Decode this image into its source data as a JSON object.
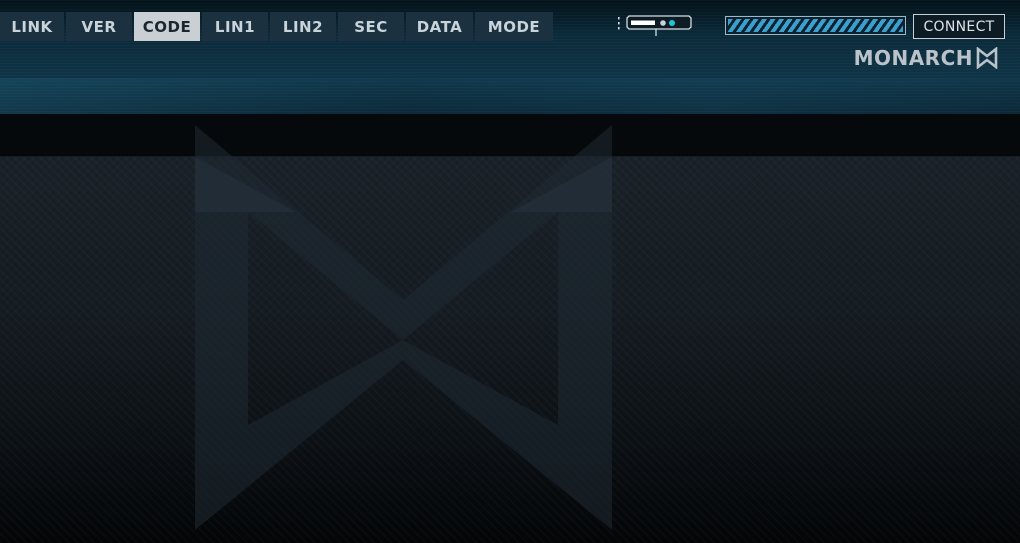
{
  "tabs": [
    {
      "label": "LINK",
      "active": false
    },
    {
      "label": "VER",
      "active": false
    },
    {
      "label": "CODE",
      "active": true
    },
    {
      "label": "LIN1",
      "active": false
    },
    {
      "label": "LIN2",
      "active": false
    },
    {
      "label": "SEC",
      "active": false
    },
    {
      "label": "DATA",
      "active": false
    },
    {
      "label": "MODE",
      "active": false
    }
  ],
  "device": {
    "icon": "device-module-icon"
  },
  "connection": {
    "level": 1.0,
    "color": "#3ca0cf"
  },
  "connect_button": {
    "label": "CONNECT"
  },
  "brand": {
    "name": "MONARCH",
    "logo": "monarch-bowtie-logo"
  },
  "colors": {
    "header": "#0f3548",
    "tab_bg": "#1c3140",
    "tab_active_bg": "#c9cfd3",
    "accent": "#3ca0cf"
  }
}
